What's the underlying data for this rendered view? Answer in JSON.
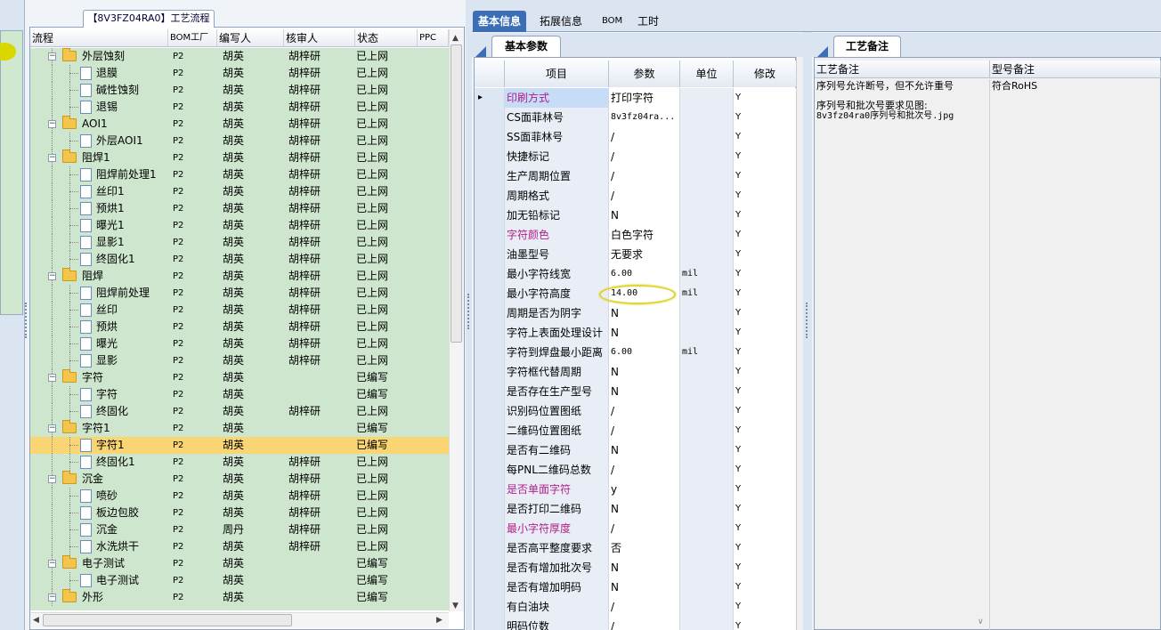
{
  "tree_panel": {
    "title": "【8V3FZ04RA0】工艺流程",
    "columns": [
      "流程",
      "BOM工厂",
      "编写人",
      "核审人",
      "状态",
      "PPC"
    ],
    "rows": [
      {
        "level": 0,
        "type": "folder",
        "name": "外层蚀刻",
        "bom": "P2",
        "writer": "胡英",
        "reviewer": "胡梓研",
        "status": "已上网"
      },
      {
        "level": 1,
        "type": "doc",
        "name": "退膜",
        "bom": "P2",
        "writer": "胡英",
        "reviewer": "胡梓研",
        "status": "已上网"
      },
      {
        "level": 1,
        "type": "doc",
        "name": "碱性蚀刻",
        "bom": "P2",
        "writer": "胡英",
        "reviewer": "胡梓研",
        "status": "已上网"
      },
      {
        "level": 1,
        "type": "doc",
        "name": "退锡",
        "bom": "P2",
        "writer": "胡英",
        "reviewer": "胡梓研",
        "status": "已上网"
      },
      {
        "level": 0,
        "type": "folder",
        "name": "AOI1",
        "bom": "P2",
        "writer": "胡英",
        "reviewer": "胡梓研",
        "status": "已上网"
      },
      {
        "level": 1,
        "type": "doc",
        "name": "外层AOI1",
        "bom": "P2",
        "writer": "胡英",
        "reviewer": "胡梓研",
        "status": "已上网"
      },
      {
        "level": 0,
        "type": "folder",
        "name": "阻焊1",
        "bom": "P2",
        "writer": "胡英",
        "reviewer": "胡梓研",
        "status": "已上网"
      },
      {
        "level": 1,
        "type": "doc",
        "name": "阻焊前处理1",
        "bom": "P2",
        "writer": "胡英",
        "reviewer": "胡梓研",
        "status": "已上网"
      },
      {
        "level": 1,
        "type": "doc",
        "name": "丝印1",
        "bom": "P2",
        "writer": "胡英",
        "reviewer": "胡梓研",
        "status": "已上网"
      },
      {
        "level": 1,
        "type": "doc",
        "name": "预烘1",
        "bom": "P2",
        "writer": "胡英",
        "reviewer": "胡梓研",
        "status": "已上网"
      },
      {
        "level": 1,
        "type": "doc",
        "name": "曝光1",
        "bom": "P2",
        "writer": "胡英",
        "reviewer": "胡梓研",
        "status": "已上网"
      },
      {
        "level": 1,
        "type": "doc",
        "name": "显影1",
        "bom": "P2",
        "writer": "胡英",
        "reviewer": "胡梓研",
        "status": "已上网"
      },
      {
        "level": 1,
        "type": "doc",
        "name": "终固化1",
        "bom": "P2",
        "writer": "胡英",
        "reviewer": "胡梓研",
        "status": "已上网"
      },
      {
        "level": 0,
        "type": "folder",
        "name": "阻焊",
        "bom": "P2",
        "writer": "胡英",
        "reviewer": "胡梓研",
        "status": "已上网"
      },
      {
        "level": 1,
        "type": "doc",
        "name": "阻焊前处理",
        "bom": "P2",
        "writer": "胡英",
        "reviewer": "胡梓研",
        "status": "已上网"
      },
      {
        "level": 1,
        "type": "doc",
        "name": "丝印",
        "bom": "P2",
        "writer": "胡英",
        "reviewer": "胡梓研",
        "status": "已上网"
      },
      {
        "level": 1,
        "type": "doc",
        "name": "预烘",
        "bom": "P2",
        "writer": "胡英",
        "reviewer": "胡梓研",
        "status": "已上网"
      },
      {
        "level": 1,
        "type": "doc",
        "name": "曝光",
        "bom": "P2",
        "writer": "胡英",
        "reviewer": "胡梓研",
        "status": "已上网"
      },
      {
        "level": 1,
        "type": "doc",
        "name": "显影",
        "bom": "P2",
        "writer": "胡英",
        "reviewer": "胡梓研",
        "status": "已上网"
      },
      {
        "level": 0,
        "type": "folder",
        "name": "字符",
        "bom": "P2",
        "writer": "胡英",
        "reviewer": "",
        "status": "已编写"
      },
      {
        "level": 1,
        "type": "doc",
        "name": "字符",
        "bom": "P2",
        "writer": "胡英",
        "reviewer": "",
        "status": "已编写"
      },
      {
        "level": 1,
        "type": "doc",
        "name": "终固化",
        "bom": "P2",
        "writer": "胡英",
        "reviewer": "胡梓研",
        "status": "已上网"
      },
      {
        "level": 0,
        "type": "folder",
        "name": "字符1",
        "bom": "P2",
        "writer": "胡英",
        "reviewer": "",
        "status": "已编写"
      },
      {
        "level": 1,
        "type": "doc",
        "name": "字符1",
        "bom": "P2",
        "writer": "胡英",
        "reviewer": "",
        "status": "已编写",
        "selected": true
      },
      {
        "level": 1,
        "type": "doc",
        "name": "终固化1",
        "bom": "P2",
        "writer": "胡英",
        "reviewer": "胡梓研",
        "status": "已上网"
      },
      {
        "level": 0,
        "type": "folder",
        "name": "沉金",
        "bom": "P2",
        "writer": "胡英",
        "reviewer": "胡梓研",
        "status": "已上网"
      },
      {
        "level": 1,
        "type": "doc",
        "name": "喷砂",
        "bom": "P2",
        "writer": "胡英",
        "reviewer": "胡梓研",
        "status": "已上网"
      },
      {
        "level": 1,
        "type": "doc",
        "name": "板边包胶",
        "bom": "P2",
        "writer": "胡英",
        "reviewer": "胡梓研",
        "status": "已上网"
      },
      {
        "level": 1,
        "type": "doc",
        "name": "沉金",
        "bom": "P2",
        "writer": "周丹",
        "reviewer": "胡梓研",
        "status": "已上网"
      },
      {
        "level": 1,
        "type": "doc",
        "name": "水洗烘干",
        "bom": "P2",
        "writer": "胡英",
        "reviewer": "胡梓研",
        "status": "已上网"
      },
      {
        "level": 0,
        "type": "folder",
        "name": "电子测试",
        "bom": "P2",
        "writer": "胡英",
        "reviewer": "",
        "status": "已编写"
      },
      {
        "level": 1,
        "type": "doc",
        "name": "电子测试",
        "bom": "P2",
        "writer": "胡英",
        "reviewer": "",
        "status": "已编写"
      },
      {
        "level": 0,
        "type": "folder",
        "name": "外形",
        "bom": "P2",
        "writer": "胡英",
        "reviewer": "",
        "status": "已编写"
      }
    ]
  },
  "top_tabs": [
    "基本信息",
    "拓展信息",
    "BOM",
    "工时"
  ],
  "basic_params": {
    "tab_label": "基本参数",
    "columns": [
      "项目",
      "参数",
      "单位",
      "修改"
    ],
    "rows": [
      {
        "item": "印刷方式",
        "param": "打印字符",
        "unit": "",
        "mod": "Y",
        "pink": true,
        "current": true
      },
      {
        "item": "CS面菲林号",
        "param": "8v3fz04ra...",
        "unit": "",
        "mod": "Y",
        "mono": true
      },
      {
        "item": "SS面菲林号",
        "param": "/",
        "unit": "",
        "mod": "Y"
      },
      {
        "item": "快捷标记",
        "param": "/",
        "unit": "",
        "mod": "Y"
      },
      {
        "item": "生产周期位置",
        "param": "/",
        "unit": "",
        "mod": "Y"
      },
      {
        "item": "周期格式",
        "param": "/",
        "unit": "",
        "mod": "Y"
      },
      {
        "item": "加无铅标记",
        "param": "N",
        "unit": "",
        "mod": "Y"
      },
      {
        "item": "字符颜色",
        "param": "白色字符",
        "unit": "",
        "mod": "Y",
        "pink": true
      },
      {
        "item": "油墨型号",
        "param": "无要求",
        "unit": "",
        "mod": "Y"
      },
      {
        "item": "最小字符线宽",
        "param": "6.00",
        "unit": "mil",
        "mod": "Y",
        "mono": true
      },
      {
        "item": "最小字符高度",
        "param": "14.00",
        "unit": "mil",
        "mod": "Y",
        "mono": true
      },
      {
        "item": "周期是否为阴字",
        "param": "N",
        "unit": "",
        "mod": "Y"
      },
      {
        "item": "字符上表面处理设计",
        "param": "N",
        "unit": "",
        "mod": "Y"
      },
      {
        "item": "字符到焊盘最小距离",
        "param": "6.00",
        "unit": "mil",
        "mod": "Y",
        "mono": true
      },
      {
        "item": "字符框代替周期",
        "param": "N",
        "unit": "",
        "mod": "Y"
      },
      {
        "item": "是否存在生产型号",
        "param": "N",
        "unit": "",
        "mod": "Y"
      },
      {
        "item": "识别码位置图纸",
        "param": "/",
        "unit": "",
        "mod": "Y"
      },
      {
        "item": "二维码位置图纸",
        "param": "/",
        "unit": "",
        "mod": "Y"
      },
      {
        "item": "是否有二维码",
        "param": "N",
        "unit": "",
        "mod": "Y"
      },
      {
        "item": "每PNL二维码总数",
        "param": "/",
        "unit": "",
        "mod": "Y"
      },
      {
        "item": "是否单面字符",
        "param": "y",
        "unit": "",
        "mod": "Y",
        "pink": true
      },
      {
        "item": "是否打印二维码",
        "param": "N",
        "unit": "",
        "mod": "Y"
      },
      {
        "item": "最小字符厚度",
        "param": "/",
        "unit": "",
        "mod": "Y",
        "pink": true
      },
      {
        "item": "是否高平整度要求",
        "param": "否",
        "unit": "",
        "mod": "Y"
      },
      {
        "item": "是否有增加批次号",
        "param": "N",
        "unit": "",
        "mod": "Y"
      },
      {
        "item": "是否有增加明码",
        "param": "N",
        "unit": "",
        "mod": "Y"
      },
      {
        "item": "有白油块",
        "param": "/",
        "unit": "",
        "mod": "Y"
      },
      {
        "item": "明码位数",
        "param": "/",
        "unit": "",
        "mod": "Y"
      }
    ]
  },
  "notes": {
    "tab_label": "工艺备注",
    "col1_header": "工艺备注",
    "col2_header": "型号备注",
    "note_line1": "序列号允许断号，但不允许重号",
    "note_line2": "序列号和批次号要求见图:",
    "note_line3": "8v3fz04ra0序列号和批次号.jpg",
    "model_note": "符合RoHS"
  }
}
